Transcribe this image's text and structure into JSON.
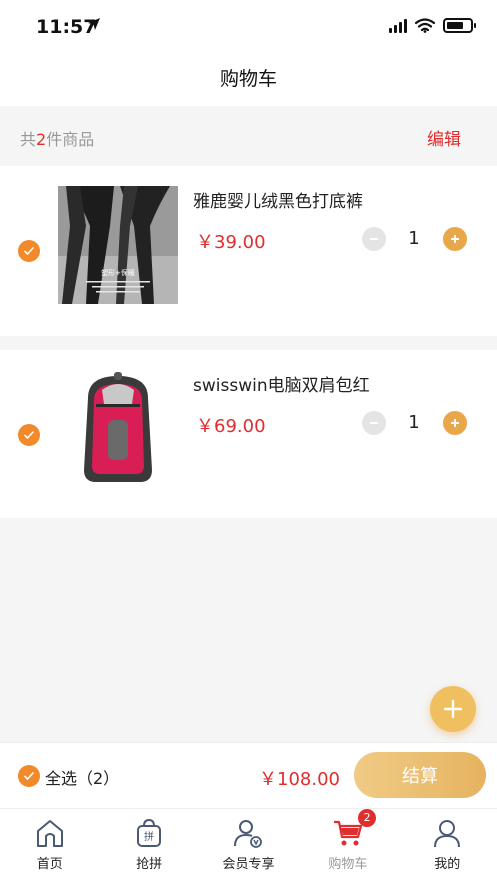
{
  "status": {
    "time": "11:57"
  },
  "nav": {
    "title": "购物车"
  },
  "summary": {
    "prefix": "共",
    "count": "2",
    "suffix": "件商品",
    "edit_label": "编辑"
  },
  "items": [
    {
      "title": "雅鹿婴儿绒黑色打底裤",
      "price": "￥39.00",
      "quantity": "1",
      "selected": true,
      "image_caption": "塑形+保暖"
    },
    {
      "title": "swisswin电脑双肩包红",
      "price": "￥69.00",
      "quantity": "1",
      "selected": true
    }
  ],
  "checkout": {
    "select_all_label": "全选（2）",
    "total": "￥108.00",
    "button_label": "结算"
  },
  "tabs": [
    {
      "label": "首页",
      "icon": "home-icon"
    },
    {
      "label": "抢拼",
      "icon": "group-buy-bag-icon"
    },
    {
      "label": "会员专享",
      "icon": "member-icon"
    },
    {
      "label": "购物车",
      "icon": "cart-icon",
      "badge": "2",
      "active": true
    },
    {
      "label": "我的",
      "icon": "profile-icon"
    }
  ],
  "colors": {
    "accent_orange": "#f28a2c",
    "price_red": "#e02e2e",
    "gold": "#e8a84a"
  }
}
